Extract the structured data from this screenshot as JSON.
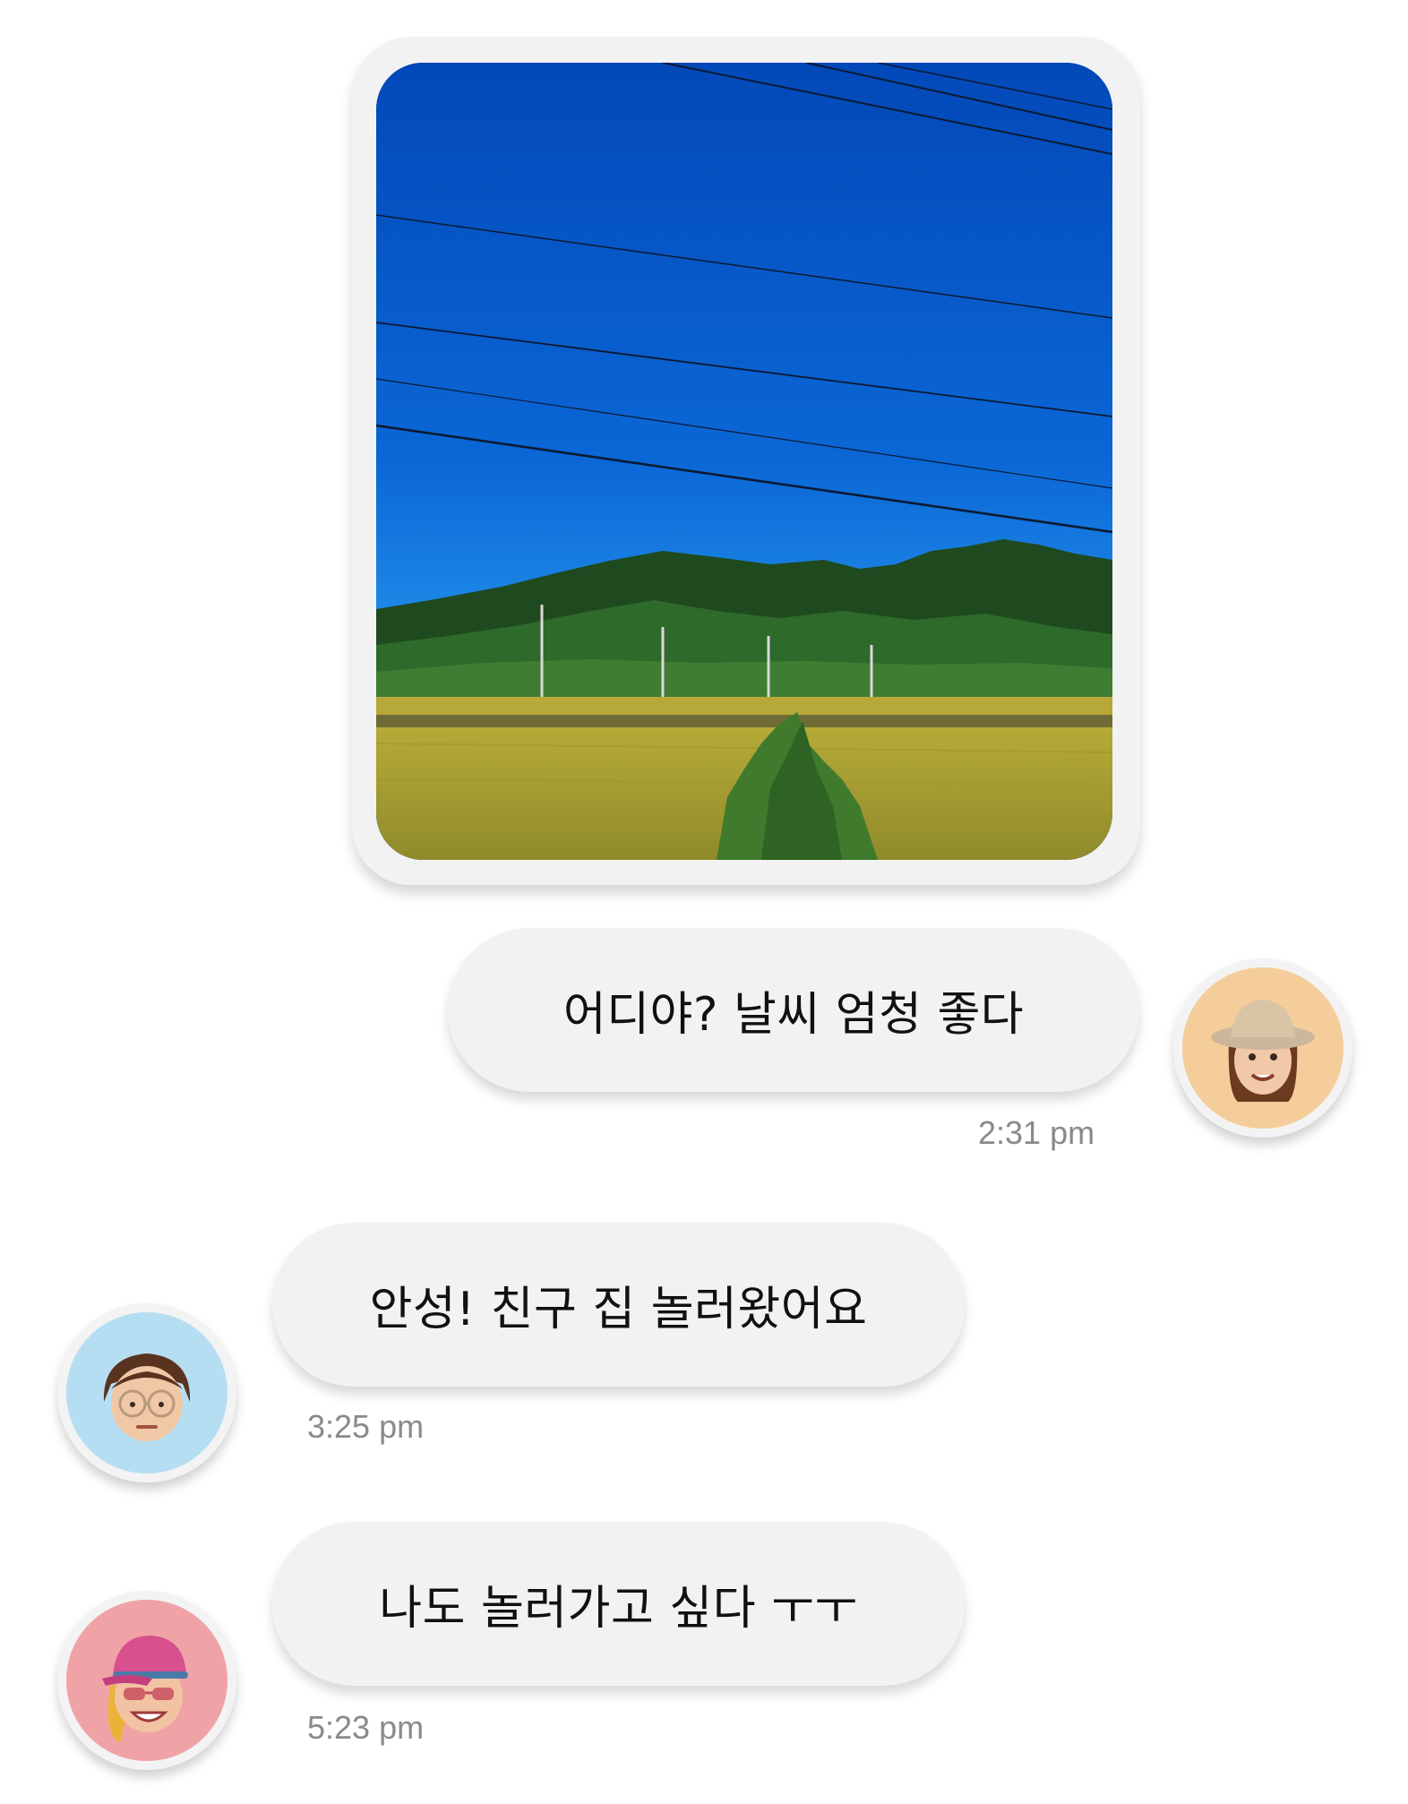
{
  "chat": {
    "photo": {
      "icon": "landscape-photo"
    },
    "messages": [
      {
        "sender": "me",
        "text": "어디야? 날씨 엄청 좋다",
        "time": "2:31 pm",
        "avatar": {
          "icon": "memoji-bucket-hat-icon",
          "bg": "#f5cd9a"
        }
      },
      {
        "sender": "friend",
        "text": "안성! 친구 집 놀러왔어요",
        "time": "3:25 pm",
        "avatar": {
          "icon": "memoji-glasses-icon",
          "bg": "#b6def2"
        }
      },
      {
        "sender": "friend",
        "text": "나도 놀러가고 싶다 ㅜㅜ",
        "time": "5:23 pm",
        "avatar": {
          "icon": "memoji-pink-cap-icon",
          "bg": "#f0a3a6"
        }
      }
    ]
  },
  "colors": {
    "bubble": "#f2f2f2",
    "timestamp": "#8a8a8a",
    "sky": "#0a5fcf",
    "field": "#b3a832"
  }
}
